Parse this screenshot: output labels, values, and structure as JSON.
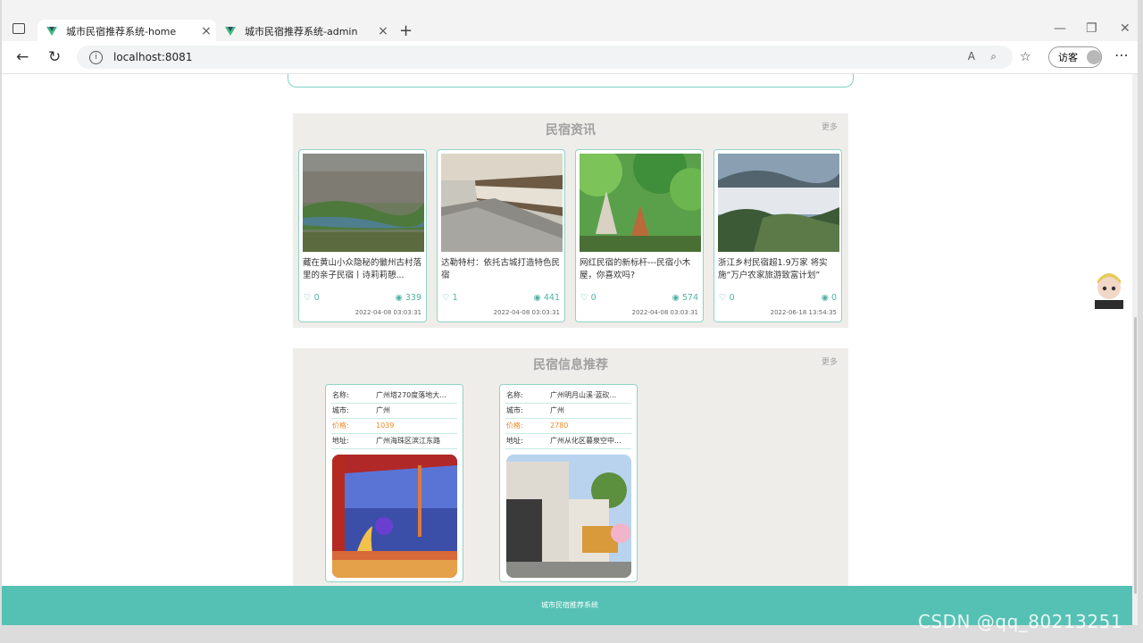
{
  "browser": {
    "tabs": [
      {
        "title": "城市民宿推荐系统-home",
        "active": true
      },
      {
        "title": "城市民宿推荐系统-admin",
        "active": false
      }
    ],
    "new_tab_symbol": "+",
    "window_controls": {
      "minimize": "—",
      "restore": "❐",
      "close": "✕"
    },
    "close_symbol": "×",
    "back_symbol": "←",
    "reload_symbol": "↻",
    "info_symbol": "i",
    "url": "localhost:8081",
    "read_aloud_symbol": "A",
    "zoom_symbol": "⌕",
    "favorites_symbol": "☆",
    "profile_label": "访客",
    "more_symbol": "⋯"
  },
  "news": {
    "title": "民宿资讯",
    "more": "更多",
    "like_icon": "♡",
    "view_icon": "◉",
    "items": [
      {
        "text": "藏在黄山小众隐秘的徽州古村落里的亲子民宿丨诗莉莉憩...",
        "likes": "0",
        "views": "339",
        "date": "2022-04-08 03:03:31"
      },
      {
        "text": "达勒特村：依托古城打造特色民宿",
        "likes": "1",
        "views": "441",
        "date": "2022-04-08 03:03:31"
      },
      {
        "text": "网红民宿的新标杆---民宿小木屋，你喜欢吗?",
        "likes": "0",
        "views": "574",
        "date": "2022-04-08 03:03:31"
      },
      {
        "text": "浙江乡村民宿超1.9万家 将实施“万户农家旅游致富计划”",
        "likes": "0",
        "views": "0",
        "date": "2022-06-18 13:54:35"
      }
    ]
  },
  "recommend": {
    "title": "民宿信息推荐",
    "more": "更多",
    "labels": {
      "name": "名称:",
      "city": "城市:",
      "price": "价格:",
      "address": "地址:"
    },
    "items": [
      {
        "name": "广州塔270度落地大...",
        "city": "广州",
        "price": "1039",
        "address": "广州海珠区滨江东路"
      },
      {
        "name": "广州明月山溪·蓝砍...",
        "city": "广州",
        "price": "2780",
        "address": "广州从化区暮泉空中..."
      }
    ]
  },
  "footer": {
    "text": "城市民宿推荐系统"
  },
  "watermark": "CSDN @qq_80213251"
}
